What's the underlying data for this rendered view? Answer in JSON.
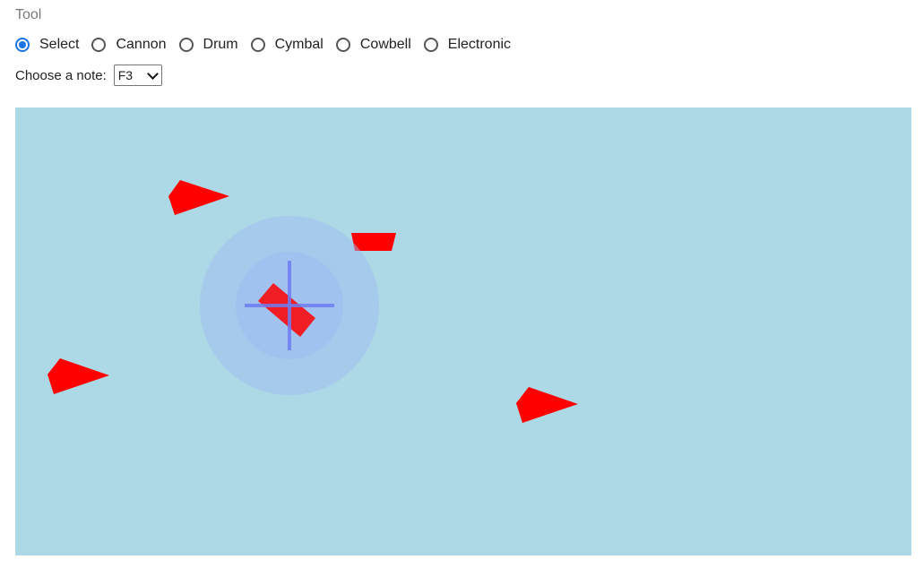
{
  "tool": {
    "label": "Tool",
    "selected": "Select",
    "options": [
      {
        "label": "Select",
        "checked": true
      },
      {
        "label": "Cannon",
        "checked": false
      },
      {
        "label": "Drum",
        "checked": false
      },
      {
        "label": "Cymbal",
        "checked": false
      },
      {
        "label": "Cowbell",
        "checked": false
      },
      {
        "label": "Electronic",
        "checked": false
      }
    ]
  },
  "note": {
    "label": "Choose a note:",
    "selected": "F3"
  },
  "canvas": {
    "background": "#add8e6",
    "shape_color": "#ff0000",
    "cursor_color": "#6f7cf2",
    "halo_color": "#9ebbf0"
  }
}
